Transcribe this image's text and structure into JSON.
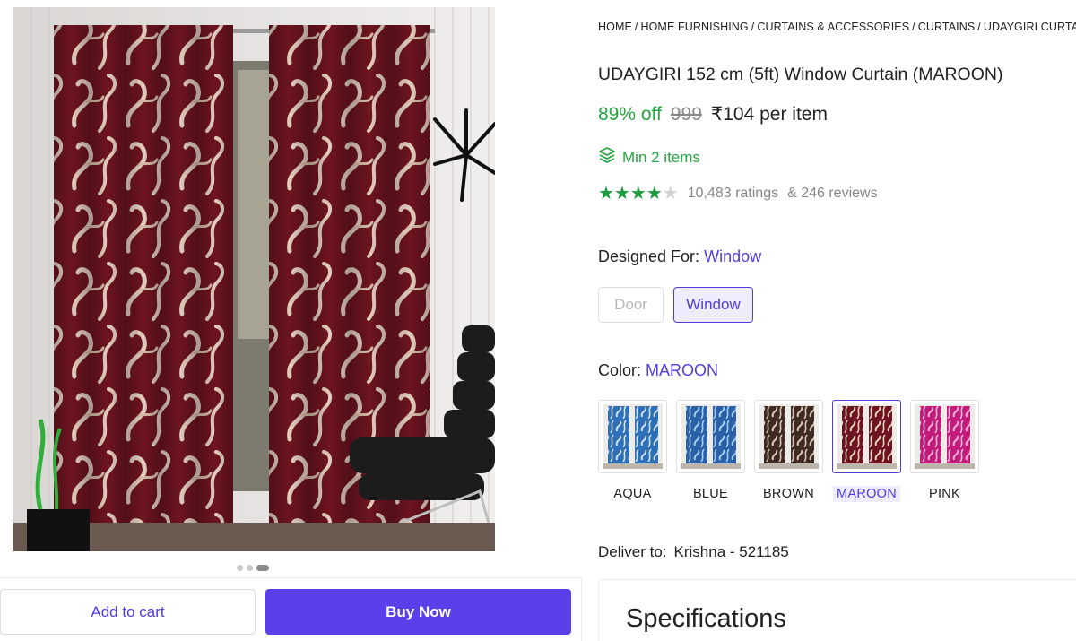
{
  "breadcrumb": [
    "HOME",
    "HOME FURNISHING",
    "CURTAINS & ACCESSORIES",
    "CURTAINS",
    "UDAYGIRI CURTAINS"
  ],
  "product": {
    "title": "UDAYGIRI 152 cm (5ft) Window Curtain (MAROON)",
    "discount": "89% off",
    "mrp": "999",
    "price": "₹104 per item",
    "min_items": "Min 2 items",
    "rating": 4,
    "ratings_text": "10,483 ratings",
    "reviews_text": "& 246 reviews"
  },
  "designed_for": {
    "label": "Designed For:",
    "selected": "Window",
    "options": [
      "Door",
      "Window"
    ]
  },
  "color": {
    "label": "Color:",
    "selected": "MAROON",
    "options": [
      {
        "name": "AQUA",
        "base": "#2f6fb8",
        "pattern": "#cfe3f5"
      },
      {
        "name": "BLUE",
        "base": "#2b5fa8",
        "pattern": "#9fd0ee"
      },
      {
        "name": "BROWN",
        "base": "#3e2a22",
        "pattern": "#d9c8b4"
      },
      {
        "name": "MAROON",
        "base": "#6d1420",
        "pattern": "#e7cfc2"
      },
      {
        "name": "PINK",
        "base": "#c21c7a",
        "pattern": "#f3b4d8"
      }
    ]
  },
  "delivery": {
    "label": "Deliver to:",
    "location": "Krishna - 521185"
  },
  "gallery": {
    "count": 3,
    "active": 2
  },
  "actions": {
    "add_to_cart": "Add to cart",
    "buy_now": "Buy Now"
  },
  "specs": {
    "title": "Specifications"
  },
  "colors": {
    "accent": "#5b3fe8",
    "green": "#26a541",
    "curtain_maroon": "#6d1420"
  }
}
